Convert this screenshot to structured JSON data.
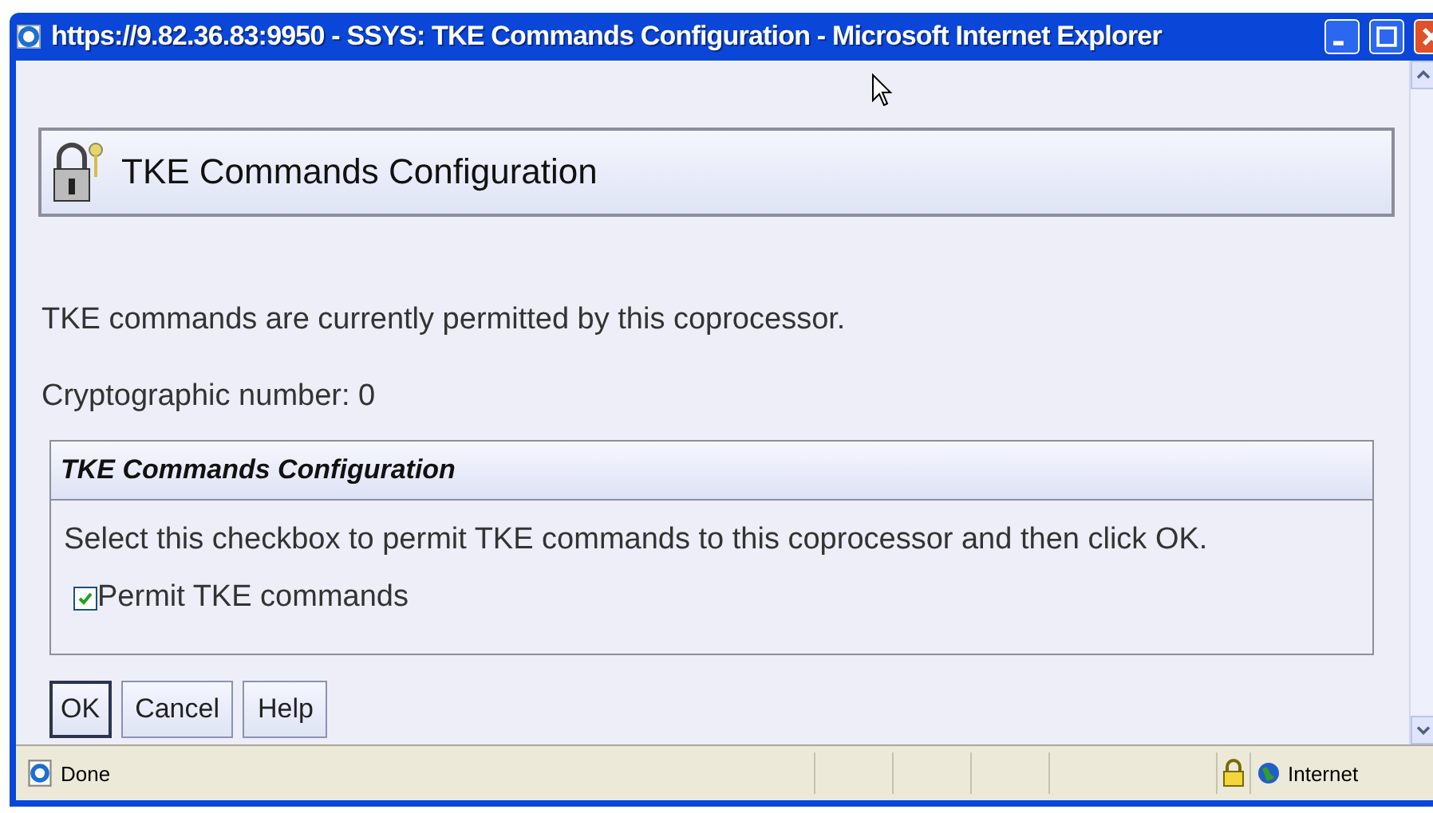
{
  "window": {
    "title": "https://9.82.36.83:9950 - SSYS: TKE Commands Configuration - Microsoft Internet Explorer"
  },
  "header": {
    "title": "TKE Commands Configuration"
  },
  "messages": [
    "TKE commands are currently permitted by this coprocessor.",
    "Cryptographic number: 0"
  ],
  "section": {
    "title": "TKE Commands Configuration",
    "instruction": "Select this checkbox to permit TKE commands to this coprocessor and then click OK.",
    "checkbox": {
      "label": "Permit TKE commands",
      "checked": true
    }
  },
  "buttons": [
    {
      "label": "OK",
      "focused": true
    },
    {
      "label": "Cancel",
      "focused": false
    },
    {
      "label": "Help",
      "focused": false
    }
  ],
  "status_bar": {
    "text": "Done",
    "zone": "Internet"
  }
}
